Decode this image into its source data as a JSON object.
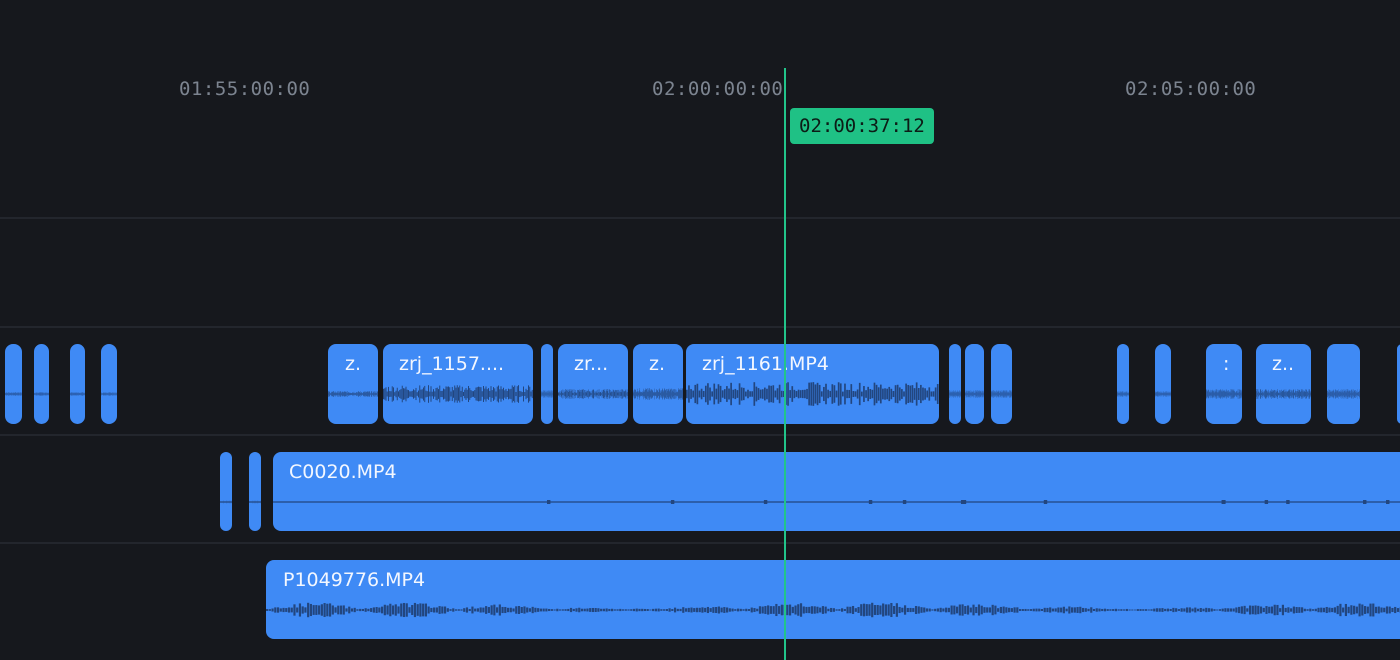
{
  "ruler": {
    "ticks": [
      "01:55:00:00",
      "02:00:00:00",
      "02:05:00:00"
    ]
  },
  "playhead": {
    "timecode": "02:00:37:12",
    "color": "#1fc185"
  },
  "colors": {
    "background": "#16181d",
    "clip": "#3f8af5",
    "waveform": "#22467f"
  },
  "tracks": {
    "audio_clips_row": {
      "labels": [
        "z.",
        "zrj_1157....",
        "zr...",
        "z.",
        "zrj_1161.MP4",
        ":",
        "z.."
      ]
    },
    "video_track_1": {
      "label": "C0020.MP4"
    },
    "video_track_2": {
      "label": "P1049776.MP4"
    }
  }
}
